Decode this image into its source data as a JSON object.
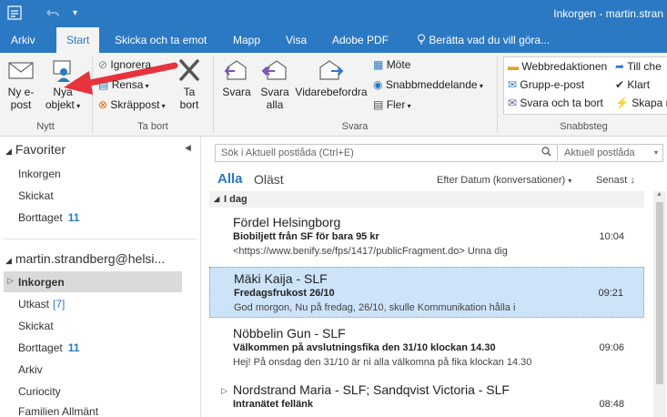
{
  "titlebar": {
    "title": "Inkorgen - martin.stran",
    "undo_icon": "undo-icon",
    "customize_icon": "chevron-down-icon"
  },
  "tabs": [
    "Arkiv",
    "Start",
    "Skicka och ta emot",
    "Mapp",
    "Visa",
    "Adobe PDF",
    "Berätta vad du vill göra..."
  ],
  "ribbon": {
    "new_email": "Ny e-\npost",
    "new_items": "Nya\nobjekt",
    "group_new": "Nytt",
    "ignore": "Ignorera",
    "clean_up": "Rensa",
    "junk": "Skräppost",
    "delete": "Ta\nbort",
    "group_delete": "Ta bort",
    "reply": "Svara",
    "reply_all": "Svara\nalla",
    "forward": "Vidarebefordra",
    "meeting": "Möte",
    "im": "Snabbmeddelande",
    "more": "Fler",
    "group_respond": "Svara",
    "qs_1": "Webbredaktionen",
    "qs_2": "Grupp-e-post",
    "qs_3": "Svara och ta bort",
    "qs_4": "Till che",
    "qs_5": "Klart",
    "qs_6": "Skapa n",
    "group_quicksteps": "Snabbsteg"
  },
  "nav": {
    "favorites": "Favoriter",
    "fav_items": [
      {
        "label": "Inkorgen",
        "count": ""
      },
      {
        "label": "Skickat",
        "count": ""
      },
      {
        "label": "Borttaget",
        "count": "11"
      }
    ],
    "account": "martin.strandberg@helsi...",
    "folders": [
      {
        "label": "Inkorgen",
        "count": ""
      },
      {
        "label": "Utkast",
        "count": "[7]"
      },
      {
        "label": "Skickat",
        "count": ""
      },
      {
        "label": "Borttaget",
        "count": "11"
      },
      {
        "label": "Arkiv",
        "count": ""
      },
      {
        "label": "Curiocity",
        "count": ""
      },
      {
        "label": "Familien Allmänt",
        "count": ""
      }
    ]
  },
  "list": {
    "search_placeholder": "Sök i Aktuell postlåda (Ctrl+E)",
    "scope": "Aktuell postlåda",
    "filter_all": "Alla",
    "filter_unread": "Oläst",
    "sort_by": "Efter Datum (konversationer)",
    "sort_dir": "Senast",
    "group_today": "I dag",
    "messages": [
      {
        "from": "Fördel Helsingborg",
        "subject": "Biobiljett från SF för bara 95 kr",
        "preview": "<https://www.benify.se/fps/1417/publicFragment.do>   Unna dig",
        "time": "10:04"
      },
      {
        "from": "Mäki Kaija - SLF",
        "subject": "Fredagsfrukost 26/10",
        "preview": "God morgon,  Nu på fredag, 26/10, skulle Kommunikation hålla i",
        "time": "09:21"
      },
      {
        "from": "Nöbbelin Gun - SLF",
        "subject": "Välkommen på avslutningsfika den 31/10 klockan 14.30",
        "preview": "Hej!  På onsdag den 31/10 är ni alla välkomna på fika klockan 14.30",
        "time": "09:06"
      },
      {
        "from": "Nordstrand Maria - SLF;  Sandqvist Victoria - SLF",
        "subject": "Intranätet fellänk",
        "preview": "",
        "time": "08:48"
      }
    ]
  },
  "colors": {
    "brand": "#2b79c2",
    "arrow": "#e8323c",
    "selection": "#cce3f8"
  }
}
